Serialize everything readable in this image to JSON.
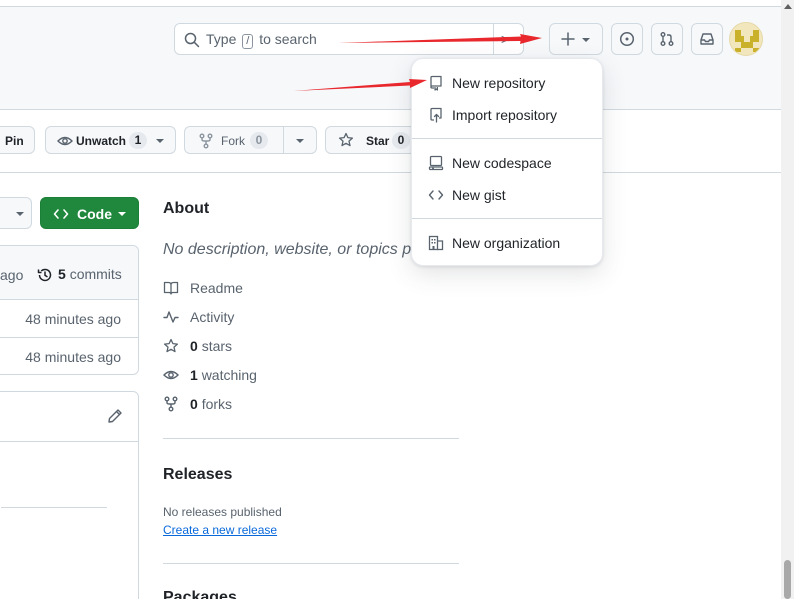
{
  "header": {
    "search_prefix": "Type",
    "search_key": "/",
    "search_suffix": "to search",
    "command_glyph": ">"
  },
  "repo_actions": {
    "pin_label": "Pin",
    "watch_label": "Unwatch",
    "watch_count": "1",
    "fork_label": "Fork",
    "fork_count": "0",
    "star_label": "Star",
    "star_count": "0"
  },
  "code_button": {
    "label": "Code"
  },
  "files": {
    "head_ago": "ago",
    "commits_count": "5",
    "commits_label": "commits",
    "rows": [
      {
        "time": "48 minutes ago"
      },
      {
        "time": "48 minutes ago"
      }
    ]
  },
  "about": {
    "title": "About",
    "description": "No description, website, or topics pro",
    "items": [
      {
        "icon": "book-icon",
        "label": "Readme"
      },
      {
        "icon": "pulse-icon",
        "label": "Activity"
      },
      {
        "icon": "star-icon",
        "count": "0",
        "label": "stars"
      },
      {
        "icon": "eye-icon",
        "count": "1",
        "label": "watching"
      },
      {
        "icon": "fork-icon",
        "count": "0",
        "label": "forks"
      }
    ]
  },
  "releases": {
    "title": "Releases",
    "none_text": "No releases published",
    "create_link": "Create a new release"
  },
  "packages": {
    "title": "Packages"
  },
  "create_menu": {
    "items": [
      {
        "icon": "repo-icon",
        "label": "New repository"
      },
      {
        "icon": "repo-push-icon",
        "label": "Import repository"
      },
      {
        "icon": "codespace-icon",
        "label": "New codespace"
      },
      {
        "icon": "code-icon",
        "label": "New gist"
      },
      {
        "icon": "organization-icon",
        "label": "New organization"
      }
    ]
  },
  "colors": {
    "accent_green": "#1f883d",
    "link_blue": "#0969da",
    "annotation_red": "#e8282d"
  }
}
